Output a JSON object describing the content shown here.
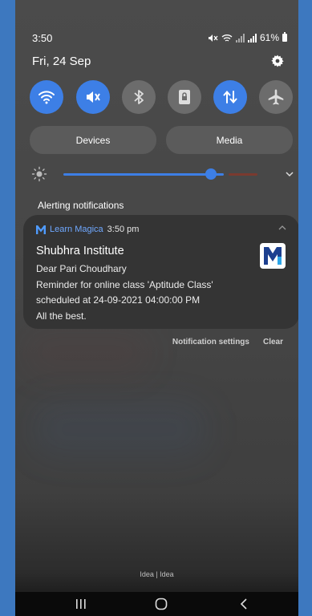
{
  "status_bar": {
    "time": "3:50",
    "battery": "61%"
  },
  "panel": {
    "date": "Fri, 24 Sep",
    "quick_settings": [
      {
        "name": "wifi",
        "state": "on"
      },
      {
        "name": "sound-mute",
        "state": "on"
      },
      {
        "name": "bluetooth",
        "state": "off"
      },
      {
        "name": "screen-lock",
        "state": "off"
      },
      {
        "name": "mobile-data",
        "state": "on"
      },
      {
        "name": "airplane",
        "state": "off"
      }
    ],
    "devices_label": "Devices",
    "media_label": "Media",
    "brightness": 0.83
  },
  "notifications": {
    "section_title": "Alerting notifications",
    "items": [
      {
        "app_name": "Learn Magica",
        "time": "3:50 pm",
        "title": "Shubhra Institute",
        "lines": [
          "Dear Pari Choudhary",
          "Reminder for online class 'Aptitude Class'",
          "scheduled at 24-09-2021 04:00:00 PM",
          "All the best."
        ]
      }
    ],
    "settings_label": "Notification settings",
    "clear_label": "Clear"
  },
  "footer": {
    "carrier_label": "Idea | Idea"
  },
  "colors": {
    "accent": "#3d7fe6",
    "panel_bg": "#474747",
    "card_bg": "#343434",
    "outer_bg": "#3d78bf"
  }
}
